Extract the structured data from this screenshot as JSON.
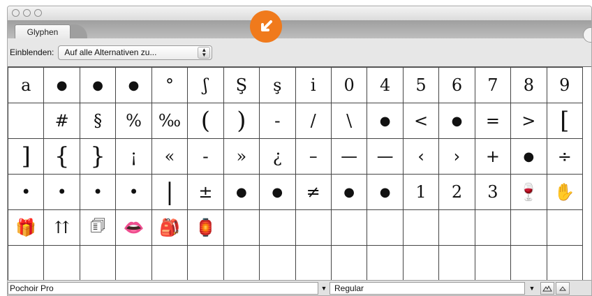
{
  "panel": {
    "tab_label": "Glyphen",
    "show_label": "Einblenden:",
    "show_select": "Auf alle Alternativen zu..."
  },
  "glyphs": [
    [
      "a",
      "●",
      "●",
      "●",
      "°",
      "ʃ",
      "Ş",
      "ş",
      "i",
      "0",
      "4",
      "5",
      "6",
      "7",
      "8",
      "9"
    ],
    [
      "",
      "#",
      "§",
      "%",
      "‰",
      "(",
      ")",
      "-",
      "/",
      "\\",
      "●",
      "<",
      "●",
      "=",
      ">",
      "["
    ],
    [
      "]",
      "{",
      "}",
      "¡",
      "«",
      "-",
      "»",
      "¿",
      "–",
      "—",
      "—",
      "‹",
      "›",
      "+",
      "●",
      "÷"
    ],
    [
      "•",
      "•",
      "•",
      "•",
      "|",
      "±",
      "●",
      "●",
      "≠",
      "●",
      "●",
      "1",
      "2",
      "3",
      "🍷",
      "✋"
    ],
    [
      "🎁",
      "⇈",
      "🗊",
      "👄",
      "🎒",
      "🏮",
      "",
      "",
      "",
      "",
      "",
      "",
      "",
      "",
      "",
      ""
    ],
    [
      "",
      "",
      "",
      "",
      "",
      "",
      "",
      "",
      "",
      "",
      "",
      "",
      "",
      "",
      "",
      ""
    ]
  ],
  "footer": {
    "font_name": "Pochoir Pro",
    "style_name": "Regular"
  },
  "colors": {
    "accent": "#f07a1c"
  }
}
